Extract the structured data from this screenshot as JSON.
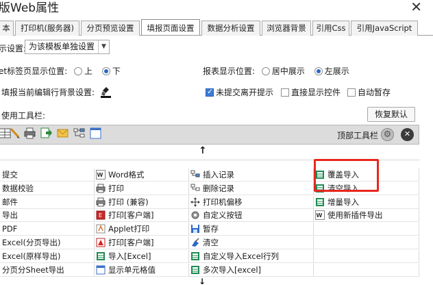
{
  "window": {
    "title": "版Web属性",
    "close_glyph": "✕"
  },
  "tabs": [
    {
      "label": "本",
      "active": false
    },
    {
      "label": "打印机(服务器)",
      "active": false
    },
    {
      "label": "分页预览设置",
      "active": false
    },
    {
      "label": "填报页面设置",
      "active": true
    },
    {
      "label": "数据分析设置",
      "active": false
    },
    {
      "label": "浏览器背景",
      "active": false
    },
    {
      "label": "引用Css",
      "active": false
    },
    {
      "label": "引用JavaScript",
      "active": false
    }
  ],
  "settings": {
    "scope_label": "示设置:",
    "scope_value": "为该模板单独设置",
    "sheet_tab_label": "et标签页显示位置:",
    "sheet_tab_options": [
      "上",
      "下"
    ],
    "sheet_tab_selected": "下",
    "report_pos_label": "报表显示位置:",
    "report_pos_options": [
      "居中展示",
      "左展示"
    ],
    "report_pos_selected": "左展示",
    "highlight_label": "填报当前编辑行背景设置:",
    "unsubmit_label": "未提交离开提示",
    "unsubmit_checked": true,
    "direct_show_label": "直接显示控件",
    "direct_show_checked": false,
    "autosave_label": "自动暂存",
    "autosave_checked": false,
    "use_toolbar_label": "使用工具栏:",
    "restore_button": "恢复默认"
  },
  "toolbar": {
    "top_label": "顶部工具栏",
    "icons": [
      "grid-icon",
      "pencil-icon",
      "printer-icon",
      "export-icon",
      "email-icon",
      "tree-icon",
      "blank-window-icon"
    ]
  },
  "grid_columns": [
    [
      {
        "label": "提交",
        "icon": "none"
      },
      {
        "label": "数据校验",
        "icon": "none"
      },
      {
        "label": "邮件",
        "icon": "none"
      },
      {
        "label": "导出",
        "icon": "none"
      },
      {
        "label": "PDF",
        "icon": "none"
      },
      {
        "label": "Excel(分页导出)",
        "icon": "none"
      },
      {
        "label": "Excel(原样导出)",
        "icon": "none"
      },
      {
        "label": "分页分Sheet导出",
        "icon": "none"
      }
    ],
    [
      {
        "label": "Word格式",
        "icon": "word-icon"
      },
      {
        "label": "打印",
        "icon": "printer-icon"
      },
      {
        "label": "打印 (兼容)",
        "icon": "printer-icon"
      },
      {
        "label": "打印[客户端]",
        "icon": "printer-red-icon"
      },
      {
        "label": "Applet打印",
        "icon": "applet-icon"
      },
      {
        "label": "打印[客户端]",
        "icon": "pdf-icon"
      },
      {
        "label": "导入[Excel]",
        "icon": "excel-icon"
      },
      {
        "label": "显示单元格值",
        "icon": "cell-icon"
      }
    ],
    [
      {
        "label": "插入记录",
        "icon": "insert-icon"
      },
      {
        "label": "删除记录",
        "icon": "delete-icon"
      },
      {
        "label": "打印机偏移",
        "icon": "move-icon"
      },
      {
        "label": "自定义按钮",
        "icon": "gear-icon"
      },
      {
        "label": "暂存",
        "icon": "save-icon"
      },
      {
        "label": "清空",
        "icon": "clear-icon"
      },
      {
        "label": "自定义导入Excel行列",
        "icon": "excel-icon"
      },
      {
        "label": "多次导入[excel]",
        "icon": "excel-icon"
      }
    ],
    [
      {
        "label": "覆盖导入",
        "icon": "excel-icon"
      },
      {
        "label": "清空导入",
        "icon": "excel-icon"
      },
      {
        "label": "增量导入",
        "icon": "excel-icon"
      },
      {
        "label": "使用新插件导出",
        "icon": "word-icon"
      },
      {
        "label": "",
        "icon": "none"
      },
      {
        "label": "",
        "icon": "none"
      },
      {
        "label": "",
        "icon": "none"
      },
      {
        "label": "",
        "icon": "none"
      }
    ]
  ],
  "colors": {
    "accent_blue": "#2a68c8",
    "highlight_red": "#e8261d",
    "excel_green": "#1e8a52"
  }
}
